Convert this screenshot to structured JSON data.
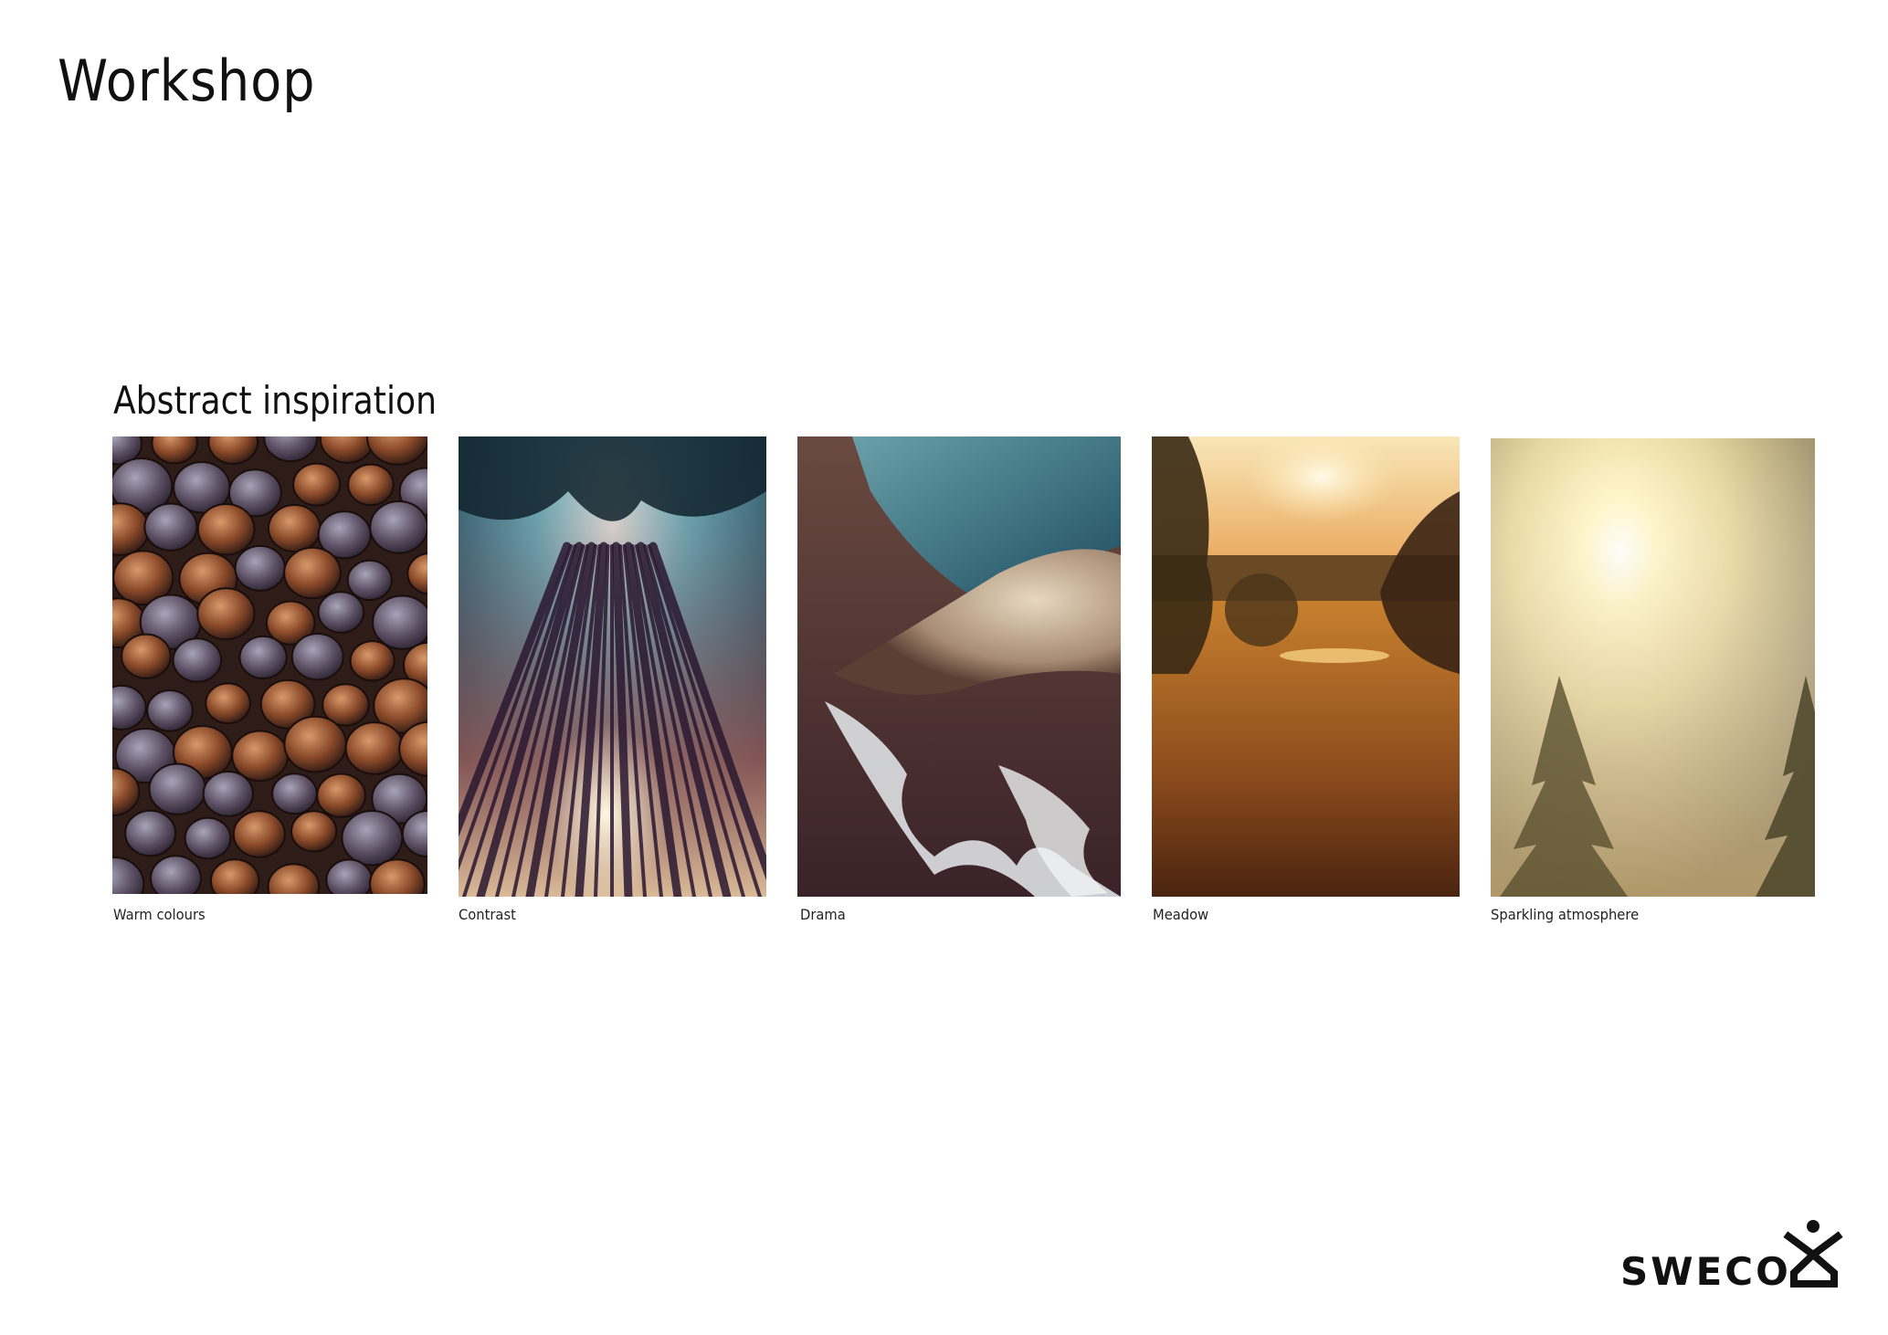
{
  "page": {
    "title": "Workshop"
  },
  "section": {
    "title": "Abstract inspiration"
  },
  "images": [
    {
      "caption": "Warm colours",
      "subject": "acorns"
    },
    {
      "caption": "Contrast",
      "subject": "tall tree trunks seen from below"
    },
    {
      "caption": "Drama",
      "subject": "aerial view of coast and clouds"
    },
    {
      "caption": "Meadow",
      "subject": "sunset over golden meadow"
    },
    {
      "caption": "Sparkling atmosphere",
      "subject": "sun through misty trees"
    }
  ],
  "logo": {
    "text": "SWECO"
  }
}
